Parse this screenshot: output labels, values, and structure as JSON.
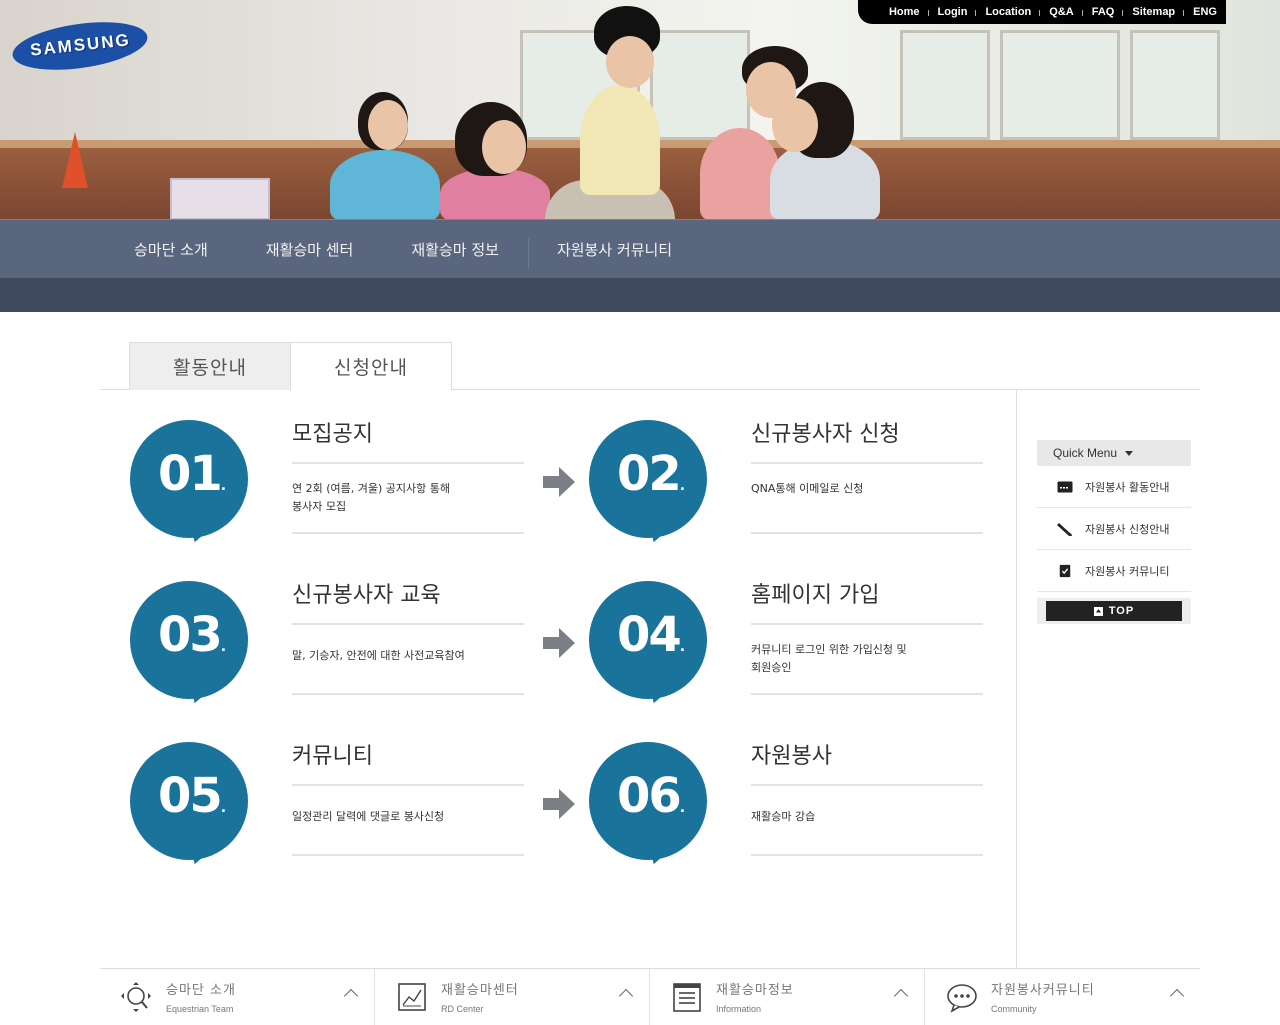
{
  "brand": {
    "logo_text": "SAMSUNG"
  },
  "utility_nav": [
    "Home",
    "Login",
    "Location",
    "Q&A",
    "FAQ",
    "Sitemap",
    "ENG"
  ],
  "main_nav": [
    "승마단 소개",
    "재활승마 센터",
    "재활승마 정보",
    "자원봉사 커뮤니티"
  ],
  "tabs": [
    {
      "label": "활동안내",
      "active": false
    },
    {
      "label": "신청안내",
      "active": true
    }
  ],
  "steps": [
    {
      "number": "01",
      "title": "모집공지",
      "desc": "연 2회 (여름, 겨울) 공지사항 통해\n봉사자 모집"
    },
    {
      "number": "02",
      "title": "신규봉사자 신청",
      "desc": "QNA통해 이메일로 신청"
    },
    {
      "number": "03",
      "title": "신규봉사자 교육",
      "desc": "말, 기승자, 안전에 대한 사전교육참여"
    },
    {
      "number": "04",
      "title": "홈페이지 가입",
      "desc": "커뮤니티 로그인 위한 가입신청 및\n회원승인"
    },
    {
      "number": "05",
      "title": "커뮤니티",
      "desc": "일정관리 달력에 댓글로 봉사신청"
    },
    {
      "number": "06",
      "title": "자원봉사",
      "desc": "재활승마 강습"
    }
  ],
  "quick_menu": {
    "title": "Quick Menu",
    "items": [
      {
        "label": "자원봉사 활동안내",
        "icon": "card-icon"
      },
      {
        "label": "자원봉사 신청안내",
        "icon": "pen-icon"
      },
      {
        "label": "자원봉사 커뮤니티",
        "icon": "checklist-icon"
      }
    ],
    "top_label": "TOP"
  },
  "footer_links": [
    {
      "title": "승마단 소개",
      "subtitle": "Equestrian Team",
      "icon": "search-compass-icon"
    },
    {
      "title": "재활승마센터",
      "subtitle": "RD Center",
      "icon": "chart-icon"
    },
    {
      "title": "재활승마정보",
      "subtitle": "Information",
      "icon": "list-icon"
    },
    {
      "title": "자원봉사커뮤니티",
      "subtitle": "Community",
      "icon": "chat-icon"
    }
  ],
  "colors": {
    "accent": "#1a739a",
    "nav": "#5a667d",
    "nav_dark": "#3f4a5e"
  }
}
